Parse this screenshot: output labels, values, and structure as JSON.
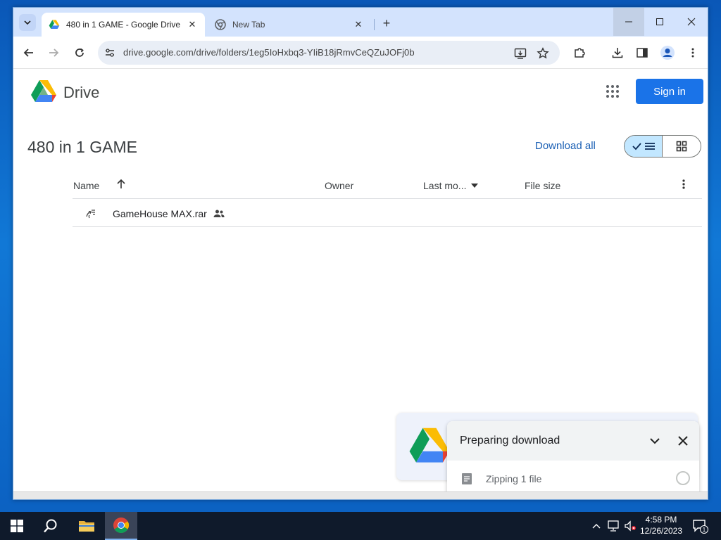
{
  "browser": {
    "tabs": [
      {
        "title": "480 in 1 GAME - Google Drive",
        "active": true,
        "icon": "google-drive-icon"
      },
      {
        "title": "New Tab",
        "active": false,
        "icon": "chrome-icon"
      }
    ],
    "url": "drive.google.com/drive/folders/1eg5IoHxbq3-YIiB18jRmvCeQZuJOFj0b"
  },
  "drive": {
    "brand": "Drive",
    "sign_in_label": "Sign in",
    "folder_title": "480 in 1 GAME",
    "download_all_label": "Download all",
    "view_mode": "list",
    "columns": {
      "name": "Name",
      "owner": "Owner",
      "last_modified": "Last mo...",
      "file_size": "File size"
    },
    "files": [
      {
        "name": "GameHouse MAX.rar",
        "shared": true,
        "owner": "",
        "last_modified": "",
        "file_size": ""
      }
    ]
  },
  "download_popup": {
    "title": "Preparing download",
    "status": "Zipping 1 file"
  },
  "taskbar": {
    "time": "4:58 PM",
    "date": "12/26/2023",
    "notification_count": "1"
  },
  "colors": {
    "accent": "#1a73e8",
    "tabstrip": "#d3e3fd",
    "omnibox": "#e9eef6",
    "view_toggle_active": "#c2e7ff"
  }
}
